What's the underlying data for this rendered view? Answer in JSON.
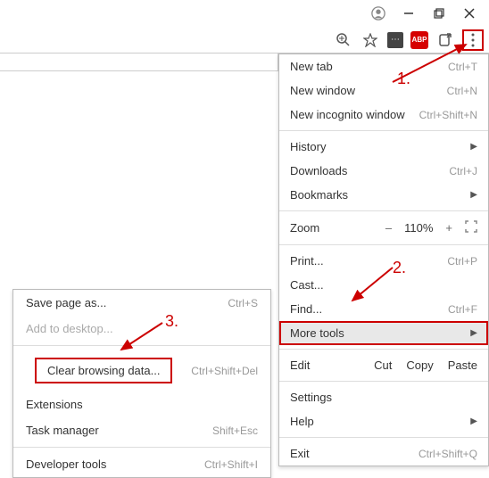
{
  "window": {
    "profile_icon": "profile"
  },
  "toolbar": {
    "zoom_icon": "zoom",
    "star_icon": "star",
    "ext1": "⋯",
    "abp": "ABP",
    "share_icon": "share",
    "menu_icon": "⋮"
  },
  "main_menu": {
    "new_tab": {
      "label": "New tab",
      "shortcut": "Ctrl+T"
    },
    "new_window": {
      "label": "New window",
      "shortcut": "Ctrl+N"
    },
    "new_incognito": {
      "label": "New incognito window",
      "shortcut": "Ctrl+Shift+N"
    },
    "history": {
      "label": "History"
    },
    "downloads": {
      "label": "Downloads",
      "shortcut": "Ctrl+J"
    },
    "bookmarks": {
      "label": "Bookmarks"
    },
    "zoom": {
      "label": "Zoom",
      "minus": "–",
      "value": "110%",
      "plus": "+",
      "full": "⛶"
    },
    "print": {
      "label": "Print...",
      "shortcut": "Ctrl+P"
    },
    "cast": {
      "label": "Cast..."
    },
    "find": {
      "label": "Find...",
      "shortcut": "Ctrl+F"
    },
    "more_tools": {
      "label": "More tools"
    },
    "edit": {
      "label": "Edit",
      "cut": "Cut",
      "copy": "Copy",
      "paste": "Paste"
    },
    "settings": {
      "label": "Settings"
    },
    "help": {
      "label": "Help"
    },
    "exit": {
      "label": "Exit",
      "shortcut": "Ctrl+Shift+Q"
    }
  },
  "submenu": {
    "save_page": {
      "label": "Save page as...",
      "shortcut": "Ctrl+S"
    },
    "add_desktop": {
      "label": "Add to desktop..."
    },
    "clear_data": {
      "label": "Clear browsing data...",
      "shortcut": "Ctrl+Shift+Del"
    },
    "extensions": {
      "label": "Extensions"
    },
    "task_manager": {
      "label": "Task manager",
      "shortcut": "Shift+Esc"
    },
    "dev_tools": {
      "label": "Developer tools",
      "shortcut": "Ctrl+Shift+I"
    }
  },
  "annotations": {
    "a1": "1.",
    "a2": "2.",
    "a3": "3."
  }
}
